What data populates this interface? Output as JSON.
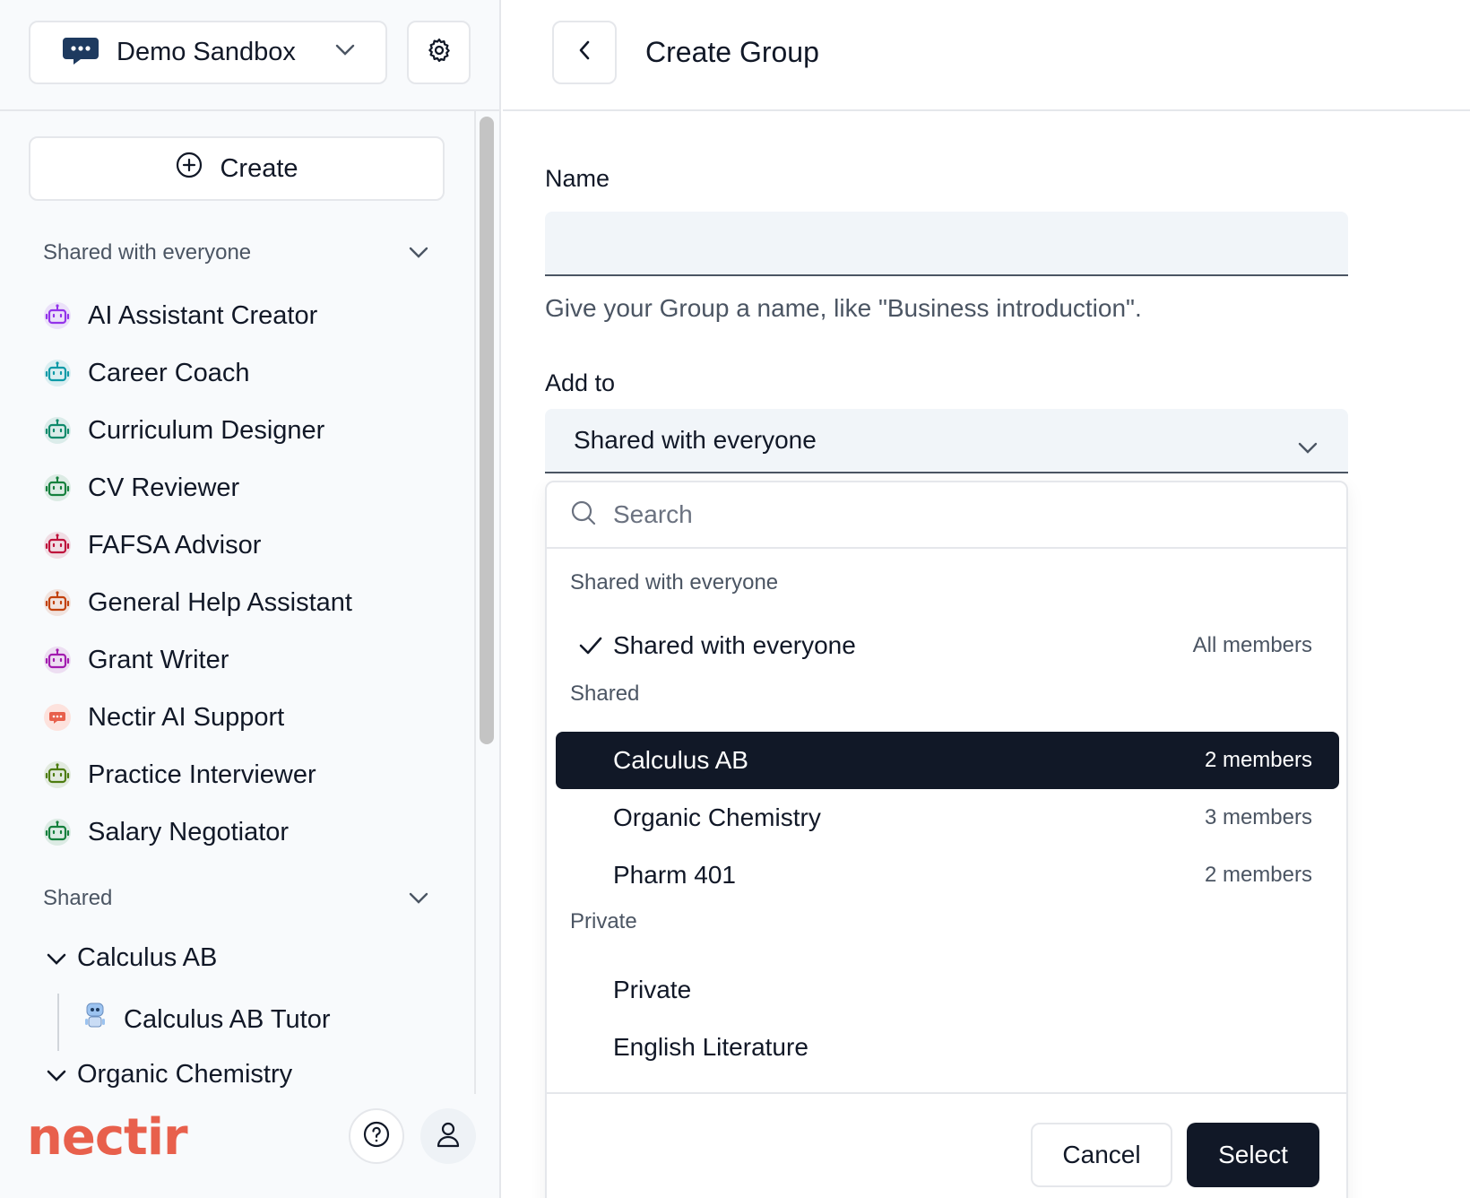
{
  "workspace": {
    "name": "Demo Sandbox"
  },
  "sidebar": {
    "create_label": "Create",
    "shared_everyone_title": "Shared with everyone",
    "bots": [
      {
        "label": "AI Assistant Creator",
        "color": "#9333ea"
      },
      {
        "label": "Career Coach",
        "color": "#0e9aa7"
      },
      {
        "label": "Curriculum Designer",
        "color": "#0f8a6b"
      },
      {
        "label": "CV Reviewer",
        "color": "#15803d"
      },
      {
        "label": "FAFSA Advisor",
        "color": "#be123c"
      },
      {
        "label": "General Help Assistant",
        "color": "#c2410c"
      },
      {
        "label": "Grant Writer",
        "color": "#a21caf"
      },
      {
        "label": "Nectir AI Support",
        "color": "#e8604c"
      },
      {
        "label": "Practice Interviewer",
        "color": "#4d7c0f"
      },
      {
        "label": "Salary Negotiator",
        "color": "#15803d"
      }
    ],
    "shared_title": "Shared",
    "groups": [
      {
        "label": "Calculus AB",
        "children": [
          {
            "label": "Calculus AB Tutor"
          }
        ]
      },
      {
        "label": "Organic Chemistry"
      }
    ]
  },
  "brand": {
    "logo_text": "nectir",
    "color": "#e8604c"
  },
  "header": {
    "title": "Create Group"
  },
  "form": {
    "name_label": "Name",
    "name_value": "",
    "name_help": "Give your Group a name, like \"Business introduction\".",
    "addto_label": "Add to",
    "addto_value": "Shared with everyone"
  },
  "dropdown": {
    "search_placeholder": "Search",
    "groups": [
      {
        "title": "Shared with everyone",
        "options": [
          {
            "label": "Shared with everyone",
            "count": "All members",
            "checked": true
          }
        ]
      },
      {
        "title": "Shared",
        "options": [
          {
            "label": "Calculus AB",
            "count": "2 members",
            "highlighted": true
          },
          {
            "label": "Organic Chemistry",
            "count": "3 members"
          },
          {
            "label": "Pharm 401",
            "count": "2 members"
          }
        ]
      },
      {
        "title": "Private",
        "options": [
          {
            "label": "Private",
            "count": ""
          },
          {
            "label": "English Literature",
            "count": ""
          }
        ]
      }
    ],
    "cancel_label": "Cancel",
    "select_label": "Select"
  }
}
